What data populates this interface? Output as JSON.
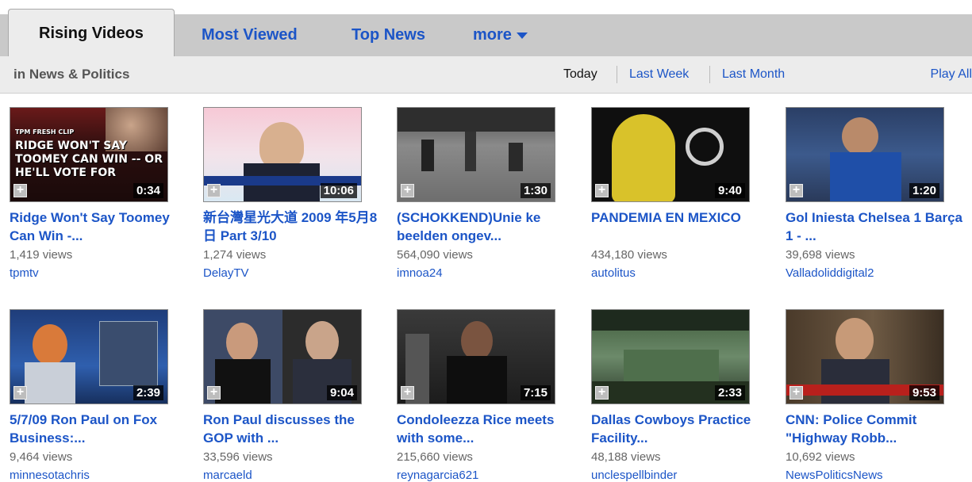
{
  "tabs": [
    {
      "label": "Rising Videos",
      "active": true
    },
    {
      "label": "Most Viewed",
      "active": false
    },
    {
      "label": "Top News",
      "active": false
    },
    {
      "label": "more",
      "active": false
    }
  ],
  "category_label": "in News & Politics",
  "periods": [
    "Today",
    "Last Week",
    "Last Month"
  ],
  "play_all": "Play All",
  "colors": {
    "link": "#1c55c7",
    "tab_strip": "#c9c9c9",
    "sub_bar": "#ececec"
  },
  "videos": [
    {
      "title": "Ridge Won't Say Toomey Can Win -...",
      "views": "1,419 views",
      "user": "tpmtv",
      "duration": "0:34",
      "overlay": [
        "TPM FRESH CLIP",
        "RIDGE WON'T SAY",
        "TOOMEY CAN WIN -- OR",
        "HE'LL VOTE FOR"
      ]
    },
    {
      "title": "新台灣星光大道 2009 年5月8日 Part 3/10",
      "views": "1,274 views",
      "user": "DelayTV",
      "duration": "10:06"
    },
    {
      "title": "(SCHOKKEND)Unie ke beelden ongev...",
      "views": "564,090 views",
      "user": "imnoa24",
      "duration": "1:30"
    },
    {
      "title": "PANDEMIA EN MEXICO",
      "views": "434,180 views",
      "user": "autolitus",
      "duration": "9:40"
    },
    {
      "title": "Gol Iniesta Chelsea 1 Barça 1 - ...",
      "views": "39,698 views",
      "user": "Valladoliddigital2",
      "duration": "1:20"
    },
    {
      "title": "5/7/09 Ron Paul on Fox Business:...",
      "views": "9,464 views",
      "user": "minnesotachris",
      "duration": "2:39"
    },
    {
      "title": "Ron Paul discusses the GOP with ...",
      "views": "33,596 views",
      "user": "marcaeld",
      "duration": "9:04"
    },
    {
      "title": "Condoleezza Rice meets with some...",
      "views": "215,660 views",
      "user": "reynagarcia621",
      "duration": "7:15"
    },
    {
      "title": "Dallas Cowboys Practice Facility...",
      "views": "48,188 views",
      "user": "unclespellbinder",
      "duration": "2:33"
    },
    {
      "title": "CNN: Police Commit \"Highway Robb...",
      "views": "10,692 views",
      "user": "NewsPoliticsNews",
      "duration": "9:53"
    }
  ]
}
